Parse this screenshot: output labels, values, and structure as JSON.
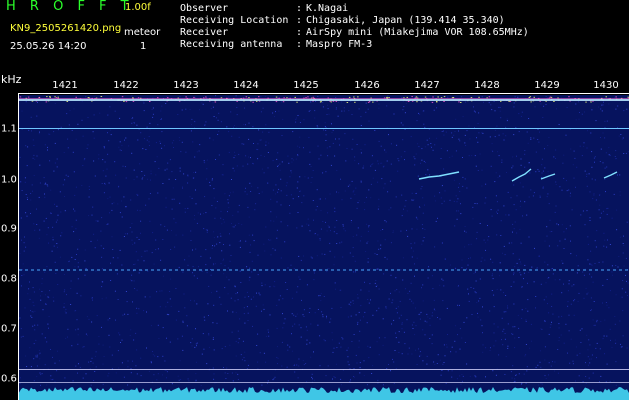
{
  "header": {
    "app_title": "H R O F F T",
    "version": "1.00f",
    "filename": "KN9_2505261420.png",
    "mode_label": "meteor",
    "mode_value": "1",
    "datetime": "25.05.26 14:20"
  },
  "info": [
    {
      "label": "Observer",
      "value": "K.Nagai"
    },
    {
      "label": "Receiving Location",
      "value": "Chigasaki, Japan (139.414 35.340)"
    },
    {
      "label": "Receiver",
      "value": "AirSpy mini (Miakejima VOR 108.65MHz)"
    },
    {
      "label": "Receiving antenna",
      "value": "Maspro FM-3"
    }
  ],
  "axes": {
    "unit": "kHz",
    "time_ticks": [
      "1421",
      "1422",
      "1423",
      "1424",
      "1425",
      "1426",
      "1427",
      "1428",
      "1429",
      "1430"
    ],
    "freq_ticks": [
      "1.1",
      "1.0",
      "0.9",
      "0.8",
      "0.7",
      "0.6"
    ]
  },
  "colors": {
    "background": "#000000",
    "header_yellow": "#ffff3a",
    "header_green": "#2bff2b",
    "noise_base": "#0a1a78",
    "carrier": "#6fc6ff"
  }
}
